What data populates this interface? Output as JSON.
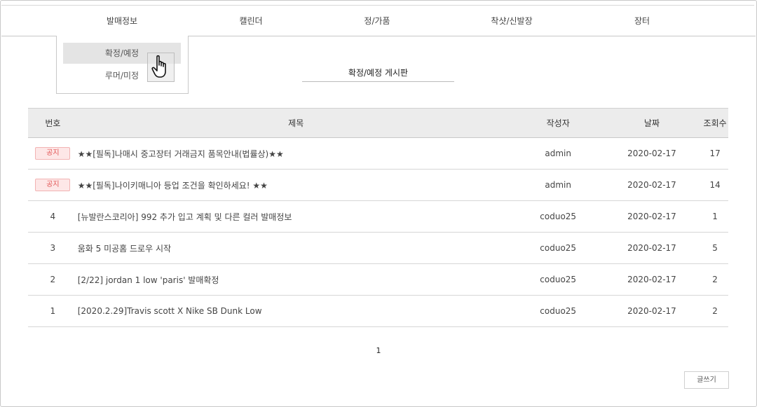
{
  "nav": {
    "items": [
      "발매정보",
      "캘린더",
      "정/가품",
      "착샷/신발장",
      "장터"
    ]
  },
  "dropdown": {
    "items": [
      "확정/예정",
      "루머/미정"
    ],
    "hovered": "확정/예정"
  },
  "board": {
    "title": "확정/예정 게시판",
    "headers": {
      "num": "번호",
      "title": "제목",
      "author": "작성자",
      "date": "날짜",
      "views": "조회수"
    },
    "notice_badge": "공지",
    "rows": [
      {
        "num": "공지",
        "title": "★★[필독]나매시 중고장터 거래금지 품목안내(법률상)★★",
        "author": "admin",
        "date": "2020-02-17",
        "views": "17",
        "notice": true
      },
      {
        "num": "공지",
        "title": "★★[필독]나이키매니아 등업 조건을 확인하세요! ★★",
        "author": "admin",
        "date": "2020-02-17",
        "views": "14",
        "notice": true
      },
      {
        "num": "4",
        "title": "[뉴발란스코리아] 992 추가 입고 계획 및 다른 컬러 발매정보",
        "author": "coduo25",
        "date": "2020-02-17",
        "views": "1",
        "notice": false
      },
      {
        "num": "3",
        "title": "움화 5 미공홈 드로우 시작",
        "author": "coduo25",
        "date": "2020-02-17",
        "views": "5",
        "notice": false
      },
      {
        "num": "2",
        "title": "[2/22] jordan 1 low 'paris' 발매확정",
        "author": "coduo25",
        "date": "2020-02-17",
        "views": "2",
        "notice": false
      },
      {
        "num": "1",
        "title": "[2020.2.29]Travis scott X Nike SB Dunk Low",
        "author": "coduo25",
        "date": "2020-02-17",
        "views": "2",
        "notice": false
      }
    ]
  },
  "pagination": {
    "current": "1"
  },
  "write_button": "글쓰기",
  "colors": {
    "notice_text": "#e8404c",
    "badge_bg": "#fde7e7",
    "header_bg": "#ececec"
  },
  "cursor_icon": "hand-pointer-icon"
}
